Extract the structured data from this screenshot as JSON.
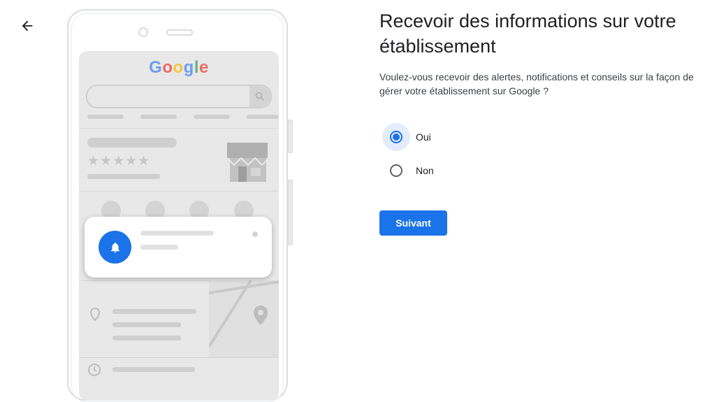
{
  "header": {
    "back_icon": "arrow-back-icon"
  },
  "illustration": {
    "google_logo": "Google",
    "google_logo_colors": [
      "#4285f4",
      "#ea4335",
      "#fbbc05",
      "#4285f4",
      "#34a853",
      "#ea4335"
    ],
    "rating_stars": "★★★★★",
    "notification_icon": "bell-icon",
    "accent": "#1a73e8"
  },
  "main": {
    "title": "Recevoir des informations sur votre établissement",
    "subtitle": "Voulez-vous recevoir des alertes, notifications et conseils sur la façon de gérer votre établissement sur Google ?",
    "options": [
      {
        "label": "Oui",
        "selected": true
      },
      {
        "label": "Non",
        "selected": false
      }
    ],
    "next_label": "Suivant"
  }
}
